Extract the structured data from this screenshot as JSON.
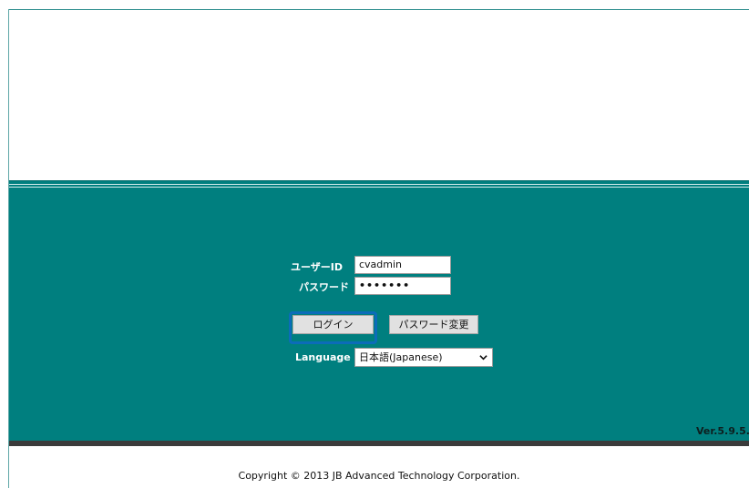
{
  "login": {
    "user_id_label": "ユーザーID",
    "user_id_value": "cvadmin",
    "password_label": "パスワード",
    "password_value": "•••••••",
    "login_button": "ログイン",
    "change_password_button": "パスワード変更",
    "language_label": "Language",
    "language_value": "日本語(Japanese)"
  },
  "version": "Ver.5.9.5.",
  "footer": {
    "copyright": "Copyright © 2013 JB Advanced Technology Corporation."
  },
  "colors": {
    "panel": "#007f7f",
    "focus_ring": "#0c6cb9",
    "band": "#3b3b3b"
  }
}
